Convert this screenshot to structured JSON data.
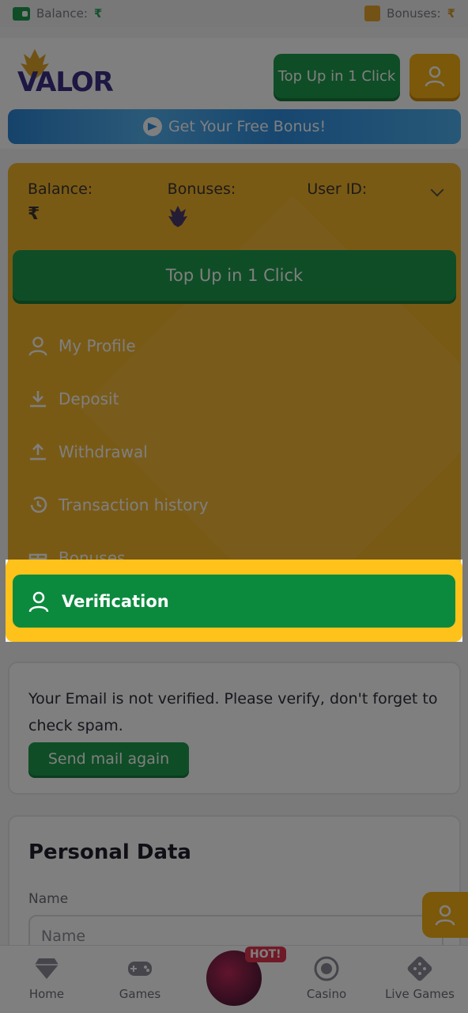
{
  "topbar": {
    "balance_label": "Balance:",
    "balance_value": "₹",
    "bonuses_label": "Bonuses:",
    "bonuses_value": "₹"
  },
  "header": {
    "logo_text": "VALOR",
    "topup_label": "Top Up in 1 Click",
    "banner_text": "Get Your Free Bonus!"
  },
  "dropdown": {
    "balance_label": "Balance:",
    "balance_value": "₹",
    "bonuses_label": "Bonuses:",
    "user_id_label": "User ID:",
    "topup_label": "Top Up in 1 Click",
    "menu": [
      {
        "label": "My Profile",
        "icon": "user-icon"
      },
      {
        "label": "Deposit",
        "icon": "download-icon"
      },
      {
        "label": "Withdrawal",
        "icon": "upload-icon"
      },
      {
        "label": "Transaction history",
        "icon": "history-icon"
      },
      {
        "label": "Bonuses",
        "icon": "gift-icon"
      }
    ],
    "verification_label": "Verification"
  },
  "email_card": {
    "message": "Your Email is not verified. Please verify, don't forget to check spam.",
    "send_label": "Send mail again"
  },
  "personal_data": {
    "title": "Personal Data",
    "name_label": "Name",
    "name_placeholder": "Name"
  },
  "bottomnav": {
    "items": [
      {
        "label": "Home",
        "icon": "diamond-icon"
      },
      {
        "label": "Games",
        "icon": "gamepad-icon"
      },
      {
        "label": "",
        "icon": "hot-game-icon"
      },
      {
        "label": "Casino",
        "icon": "chip-icon"
      },
      {
        "label": "Live Games",
        "icon": "dice-icon"
      }
    ],
    "hot_badge": "HOT!"
  },
  "colors": {
    "green": "#1f9b4d",
    "verification_green": "#0b8a3e",
    "yellow": "#f3b42a",
    "highlight": "#ffc21a",
    "brand_purple": "#3a2f87"
  }
}
